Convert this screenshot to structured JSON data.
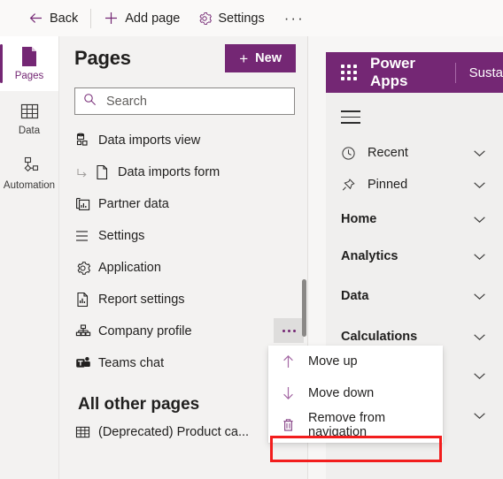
{
  "commandbar": {
    "items": [
      {
        "label": "Back",
        "icon": "arrow-left-icon"
      },
      {
        "label": "Add page",
        "icon": "plus-icon"
      },
      {
        "label": "Settings",
        "icon": "gear-icon"
      }
    ],
    "more_label": "···"
  },
  "rail": {
    "items": [
      {
        "label": "Pages",
        "icon": "page-icon",
        "selected": true
      },
      {
        "label": "Data",
        "icon": "table-icon",
        "selected": false
      },
      {
        "label": "Automation",
        "icon": "flow-icon",
        "selected": false
      }
    ]
  },
  "pages": {
    "title": "Pages",
    "new_button": "New",
    "new_plus": "+",
    "search_placeholder": "Search",
    "search_value": "",
    "list": [
      {
        "label": "Data imports view",
        "icon": "entity-view-icon",
        "type": "item"
      },
      {
        "label": "Data imports form",
        "icon": "form-icon",
        "type": "child"
      },
      {
        "label": "Partner data",
        "icon": "dashboard-icon",
        "type": "item"
      },
      {
        "label": "Settings",
        "icon": "list-group-icon",
        "type": "group"
      },
      {
        "label": "Application",
        "icon": "gear-icon",
        "type": "item"
      },
      {
        "label": "Report settings",
        "icon": "report-icon",
        "type": "item"
      },
      {
        "label": "Company profile",
        "icon": "org-chart-icon",
        "type": "item",
        "has_menu": true,
        "menu_label": "···"
      },
      {
        "label": "Teams chat",
        "icon": "teams-icon",
        "type": "item"
      }
    ],
    "other_section_title": "All other pages",
    "other_list": [
      {
        "label": "(Deprecated) Product ca...",
        "icon": "table-icon",
        "type": "item"
      }
    ]
  },
  "context_menu": {
    "items": [
      {
        "label": "Move up",
        "icon": "arrow-up-icon",
        "highlighted": false
      },
      {
        "label": "Move down",
        "icon": "arrow-down-icon",
        "highlighted": false
      },
      {
        "label": "Remove from navigation",
        "icon": "trash-icon",
        "highlighted": true
      }
    ]
  },
  "preview": {
    "app_title": "Power Apps",
    "environment": "Susta",
    "nav": [
      {
        "label": "Recent",
        "icon": "clock-icon",
        "bold": false,
        "chevron": "chevron-down-icon"
      },
      {
        "label": "Pinned",
        "icon": "pin-icon",
        "bold": false,
        "chevron": "chevron-down-icon"
      },
      {
        "label": "Home",
        "icon": "",
        "bold": true,
        "chevron": "chevron-down-icon"
      },
      {
        "label": "Analytics",
        "icon": "",
        "bold": true,
        "chevron": "chevron-down-icon"
      },
      {
        "label": "Data",
        "icon": "",
        "bold": true,
        "chevron": "chevron-down-icon"
      },
      {
        "label": "Calculations",
        "icon": "",
        "bold": true,
        "chevron": "chevron-down-icon"
      },
      {
        "label": "",
        "icon": "",
        "bold": true,
        "chevron": "chevron-down-icon"
      },
      {
        "label": "",
        "icon": "",
        "bold": true,
        "chevron": "chevron-down-icon"
      }
    ]
  },
  "colors": {
    "brand_purple": "#742774",
    "highlight_red": "#f21d1d",
    "panel_bg": "#f3f2f1"
  }
}
